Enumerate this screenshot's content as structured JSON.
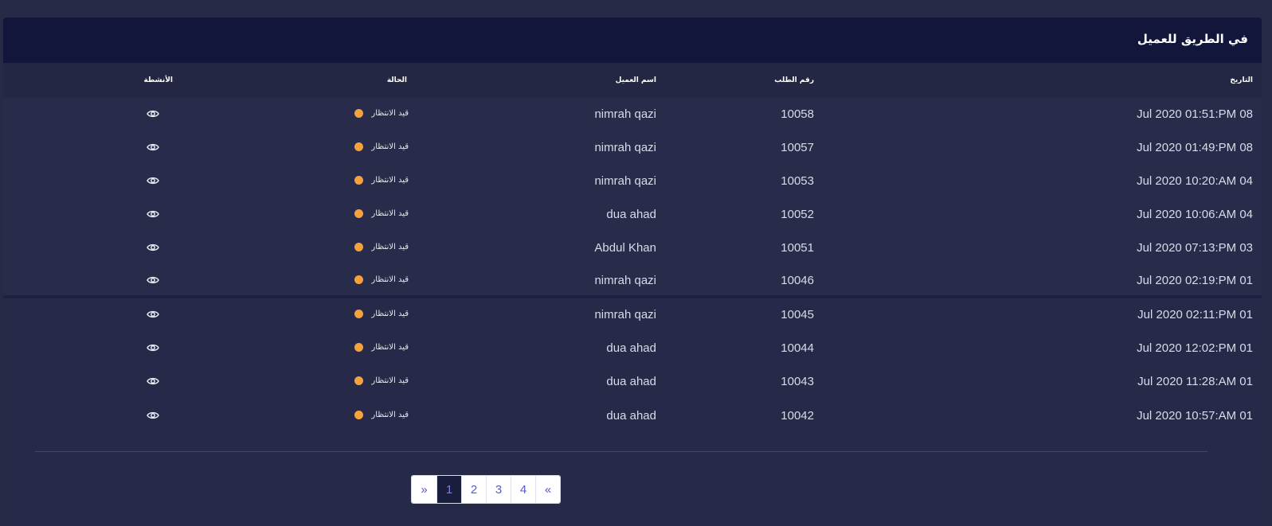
{
  "card": {
    "title": "في الطريق للعميل"
  },
  "columns": {
    "date": "التاريخ",
    "order": "رقم الطلب",
    "customer": "اسم العميل",
    "status": "الحالة",
    "actions": "الأنشطة"
  },
  "rows": [
    {
      "date": "Jul 2020 01:51:PM 08",
      "order": "10058",
      "customer": "nimrah qazi",
      "status": "قيد الانتظار"
    },
    {
      "date": "Jul 2020 01:49:PM 08",
      "order": "10057",
      "customer": "nimrah qazi",
      "status": "قيد الانتظار"
    },
    {
      "date": "Jul 2020 10:20:AM 04",
      "order": "10053",
      "customer": "nimrah qazi",
      "status": "قيد الانتظار"
    },
    {
      "date": "Jul 2020 10:06:AM 04",
      "order": "10052",
      "customer": "dua ahad",
      "status": "قيد الانتظار"
    },
    {
      "date": "Jul 2020 07:13:PM 03",
      "order": "10051",
      "customer": "Abdul Khan",
      "status": "قيد الانتظار"
    },
    {
      "date": "Jul 2020 02:19:PM 01",
      "order": "10046",
      "customer": "nimrah qazi",
      "status": "قيد الانتظار"
    },
    {
      "date": "Jul 2020 02:11:PM 01",
      "order": "10045",
      "customer": "nimrah qazi",
      "status": "قيد الانتظار"
    },
    {
      "date": "Jul 2020 12:02:PM 01",
      "order": "10044",
      "customer": "dua ahad",
      "status": "قيد الانتظار"
    },
    {
      "date": "Jul 2020 11:28:AM 01",
      "order": "10043",
      "customer": "dua ahad",
      "status": "قيد الانتظار"
    },
    {
      "date": "Jul 2020 10:57:AM 01",
      "order": "10042",
      "customer": "dua ahad",
      "status": "قيد الانتظار"
    }
  ],
  "status_color": "#f7a13b",
  "action_icon": "eye-icon",
  "pagination": {
    "prev": "»",
    "pages": [
      "1",
      "2",
      "3",
      "4"
    ],
    "next": "«",
    "current": "1"
  }
}
